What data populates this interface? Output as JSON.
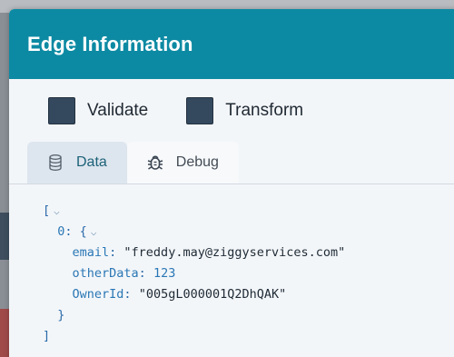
{
  "modal": {
    "title": "Edge Information",
    "checkboxes": [
      {
        "label": "Validate"
      },
      {
        "label": "Transform"
      }
    ],
    "tabs": [
      {
        "label": "Data",
        "icon": "database-icon",
        "active": true
      },
      {
        "label": "Debug",
        "icon": "bug-icon",
        "active": false
      }
    ]
  },
  "json_view": {
    "open_bracket": "[",
    "close_bracket": "]",
    "index_key": "0",
    "open_brace": "{",
    "close_brace": "}",
    "fields": [
      {
        "key": "email",
        "value": "\"freddy.may@ziggyservices.com\""
      },
      {
        "key": "otherData",
        "value": "123"
      },
      {
        "key": "OwnerId",
        "value": "\"005gL000001Q2DhQAK\""
      }
    ],
    "collapse_glyph": "⌵"
  },
  "colors": {
    "header": "#0d8aa3",
    "checkbox": "#34495e",
    "active_tab_bg": "#dde5ee"
  }
}
